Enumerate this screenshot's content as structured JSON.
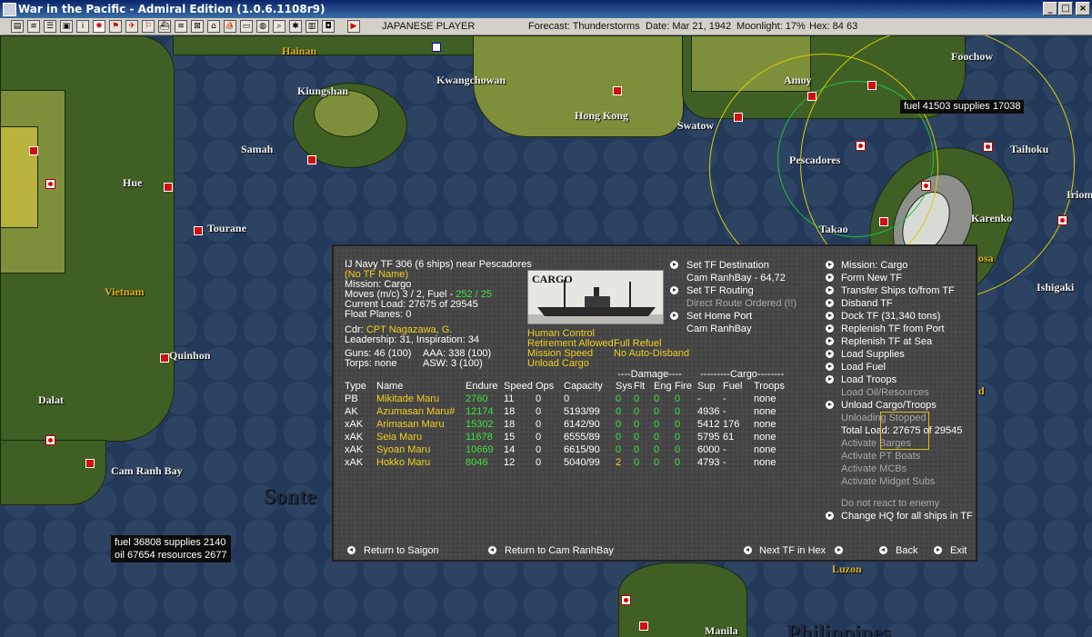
{
  "window": {
    "title": "War in the Pacific - Admiral Edition (1.0.6.1108r9)",
    "min_glyph": "_",
    "max_glyph": "□",
    "close_glyph": "×"
  },
  "toolbar": {
    "player": "JAPANESE PLAYER",
    "forecast": "Forecast: Thunderstorms",
    "date": "Date: Mar 21, 1942",
    "moonlight": "Moonlight: 17%",
    "hex": "Hex: 84 63"
  },
  "map": {
    "labels": [
      "Hainan",
      "Kiungshan",
      "Kwangchowan",
      "Hong Kong",
      "Swatow",
      "Amoy",
      "Foochow",
      "Samah",
      "Pescadores",
      "Taihoku",
      "Iriom",
      "Hue",
      "Tourane",
      "Takao",
      "Karenko",
      "Vietnam",
      "osa",
      "Ishigaki",
      "Quinhon",
      "Dalat",
      "Cam Ranh Bay",
      "Luzon",
      "Manila",
      "Philippines",
      "Sonte",
      "d"
    ],
    "info_top": "fuel 41503 supplies 17038",
    "info_bottom_1": "fuel 36808 supplies 2140",
    "info_bottom_2": "oil 67654 resources 2677"
  },
  "tf": {
    "header": "IJ Navy TF 306 (6 ships) near Pescadores",
    "name": "(No TF Name)",
    "mission": "Mission: Cargo",
    "moves_label": "Moves (m/c)  3 / 2, Fuel - ",
    "fuel": "252 / 25",
    "current_load": "Current Load:  27675 of 29545",
    "float_planes": "Float Planes:  0",
    "cdr_label": "Cdr:",
    "cdr": "CPT  Nagazawa, G.",
    "leadership": "Leadership: 31, Inspiration: 34",
    "guns": "Guns: 46 (100)",
    "aaa": "AAA: 338 (100)",
    "torps": "Torps: none",
    "asw": "ASW: 3 (100)",
    "image_label": "CARGO",
    "control": "Human Control",
    "retirement": "Retirement Allowed",
    "refuel": "Full Refuel",
    "mission_speed": "Mission Speed",
    "auto_disband": "No Auto-Disband",
    "unload": "Unload Cargo"
  },
  "mid_actions": {
    "set_destination": "Set TF Destination",
    "destination": "Cam RanhBay - 64,72",
    "set_routing": "Set TF Routing",
    "direct_route": "Direct Route Ordered (!!)",
    "set_home": "Set Home Port",
    "home": "Cam RanhBay"
  },
  "right_actions": {
    "mission": "Mission: Cargo",
    "form_new": "Form New TF",
    "transfer": "Transfer Ships to/from TF",
    "disband": "Disband TF",
    "dock": "Dock TF (31,340 tons)",
    "replenish_port": "Replenish TF from Port",
    "replenish_sea": "Replenish TF at Sea",
    "load_supplies": "Load Supplies",
    "load_fuel": "Load Fuel",
    "load_troops": "Load Troops",
    "load_oil": "Load Oil/Resources",
    "unload": "Unload Cargo/Troops",
    "unloading_stopped": "Unloading Stopped",
    "total_load": "Total Load: 27675 of 29545",
    "barges": "Activate Barges",
    "pt_boats": "Activate PT Boats",
    "mcbs": "Activate MCBs",
    "midget": "Activate Midget Subs",
    "no_react": "Do not react to enemy",
    "change_hq": "Change HQ for all ships in TF"
  },
  "table": {
    "group_damage": "----Damage----",
    "group_cargo": "---------Cargo--------",
    "headers": {
      "type": "Type",
      "name": "Name",
      "endure": "Endure",
      "speed": "Speed",
      "ops": "Ops",
      "capacity": "Capacity",
      "sys": "Sys",
      "flt": "Flt",
      "eng": "Eng",
      "fire": "Fire",
      "sup": "Sup",
      "fuel": "Fuel",
      "troops": "Troops"
    },
    "rows": [
      {
        "type": "PB",
        "name": "Mikitade Maru",
        "endure": "2760",
        "speed": "11",
        "ops": "0",
        "capacity": "0",
        "sys": "0",
        "flt": "0",
        "eng": "0",
        "fire": "0",
        "sup": "-",
        "fuel": "-",
        "troops": "none"
      },
      {
        "type": "AK",
        "name": "Azumasan Maru#",
        "endure": "12174",
        "speed": "18",
        "ops": "0",
        "capacity": "5193/99",
        "sys": "0",
        "flt": "0",
        "eng": "0",
        "fire": "0",
        "sup": "4936",
        "fuel": "-",
        "troops": "none"
      },
      {
        "type": "xAK",
        "name": "Arimasan Maru",
        "endure": "15302",
        "speed": "18",
        "ops": "0",
        "capacity": "6142/90",
        "sys": "0",
        "flt": "0",
        "eng": "0",
        "fire": "0",
        "sup": "5412",
        "fuel": "176",
        "troops": "none"
      },
      {
        "type": "xAK",
        "name": "Seia Maru",
        "endure": "11678",
        "speed": "15",
        "ops": "0",
        "capacity": "6555/89",
        "sys": "0",
        "flt": "0",
        "eng": "0",
        "fire": "0",
        "sup": "5795",
        "fuel": "61",
        "troops": "none"
      },
      {
        "type": "xAK",
        "name": "Syoan Maru",
        "endure": "10669",
        "speed": "14",
        "ops": "0",
        "capacity": "6615/90",
        "sys": "0",
        "flt": "0",
        "eng": "0",
        "fire": "0",
        "sup": "6000",
        "fuel": "-",
        "troops": "none"
      },
      {
        "type": "xAK",
        "name": "Hokko Maru",
        "endure": "8046",
        "speed": "12",
        "ops": "0",
        "capacity": "5040/99",
        "sys": "2",
        "flt": "0",
        "eng": "0",
        "fire": "0",
        "sup": "4793",
        "fuel": "-",
        "troops": "none"
      }
    ]
  },
  "footer": {
    "return_saigon": "Return to Saigon",
    "return_cam": "Return to Cam RanhBay",
    "next_tf": "Next TF in Hex",
    "back": "Back",
    "exit": "Exit"
  }
}
